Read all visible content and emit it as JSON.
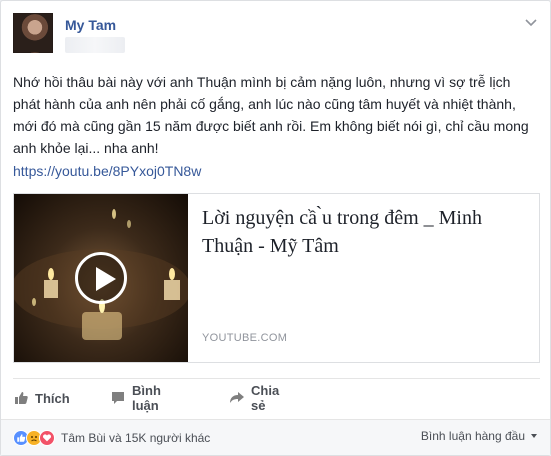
{
  "post": {
    "author": "My Tam",
    "text": "Nhớ hồi thâu bài này với anh Thuận mình bị cảm nặng luôn, nhưng vì sợ trễ lịch phát hành của anh nên phải cố gắng, anh lúc nào cũng tâm huyết và nhiệt thành, mới đó mà cũng gần 15 năm được biết anh rồi. Em không biết nói gì, chỉ cầu mong anh khỏe lại... nha anh!",
    "link_url": "https://youtu.be/8PYxoj0TN8w"
  },
  "link_preview": {
    "title": "Lời nguyện cầ ̀u trong đêm _ Minh Thuận - Mỹ Tâm",
    "domain": "YOUTUBE.COM"
  },
  "actions": {
    "like_label": "Thích",
    "comment_label": "Bình luận",
    "share_label": "Chia sẻ"
  },
  "footer": {
    "reaction_names": "Tâm Bùi và 15K người khác",
    "comment_sort_label": "Bình luận hàng đầu"
  },
  "colors": {
    "link": "#365899",
    "text": "#1d2129",
    "muted": "#4b4f56",
    "like": "#5890ff",
    "sad": "#f7b125",
    "love": "#f25268"
  },
  "icons": [
    "chevron-down-icon",
    "play-icon",
    "like-icon",
    "comment-icon",
    "share-icon",
    "like-reaction-icon",
    "sad-reaction-icon",
    "love-reaction-icon",
    "caret-down-icon"
  ]
}
